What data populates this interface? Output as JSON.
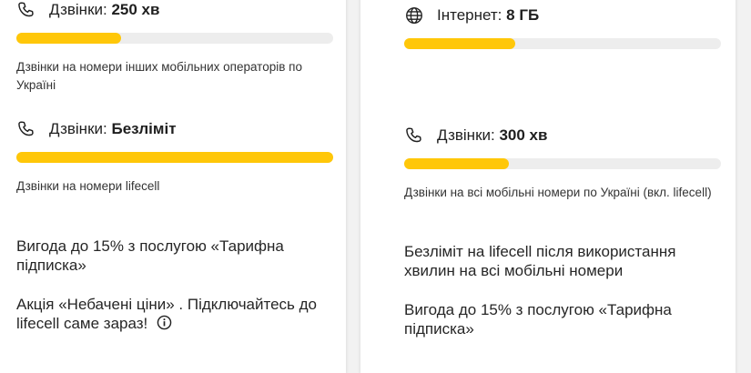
{
  "left_card": {
    "calls_other": {
      "label": "Дзвінки:",
      "value": "250 хв",
      "icon": "phone-icon",
      "progress": 0.33,
      "note": "Дзвінки на номери інших мобільних операторів по Україні"
    },
    "calls_lifecell": {
      "label": "Дзвінки:",
      "value": "Безліміт",
      "icon": "phone-icon",
      "progress": 1.0,
      "note": "Дзвінки на номери lifecell"
    },
    "benefit_text": "Вигода до 15% з послугою «Тарифна підписка»",
    "promo_text": "Акція «Небачені ціни» . Підключайтесь до lifecell саме зараз!"
  },
  "right_card": {
    "internet": {
      "label": "Інтернет:",
      "value": "8 ГБ",
      "icon": "globe-icon",
      "progress": 0.35
    },
    "calls_all": {
      "label": "Дзвінки:",
      "value": "300 хв",
      "icon": "phone-icon",
      "progress": 0.33,
      "note": "Дзвінки на всі мобільні номери по Україні (вкл. lifecell)"
    },
    "unlimited_text": "Безліміт на lifecell після використання хвилин на всі мобільні номери",
    "benefit_text": "Вигода до 15% з послугою «Тарифна підписка»"
  },
  "colors": {
    "accent": "#ffc709",
    "track": "#ededed"
  }
}
